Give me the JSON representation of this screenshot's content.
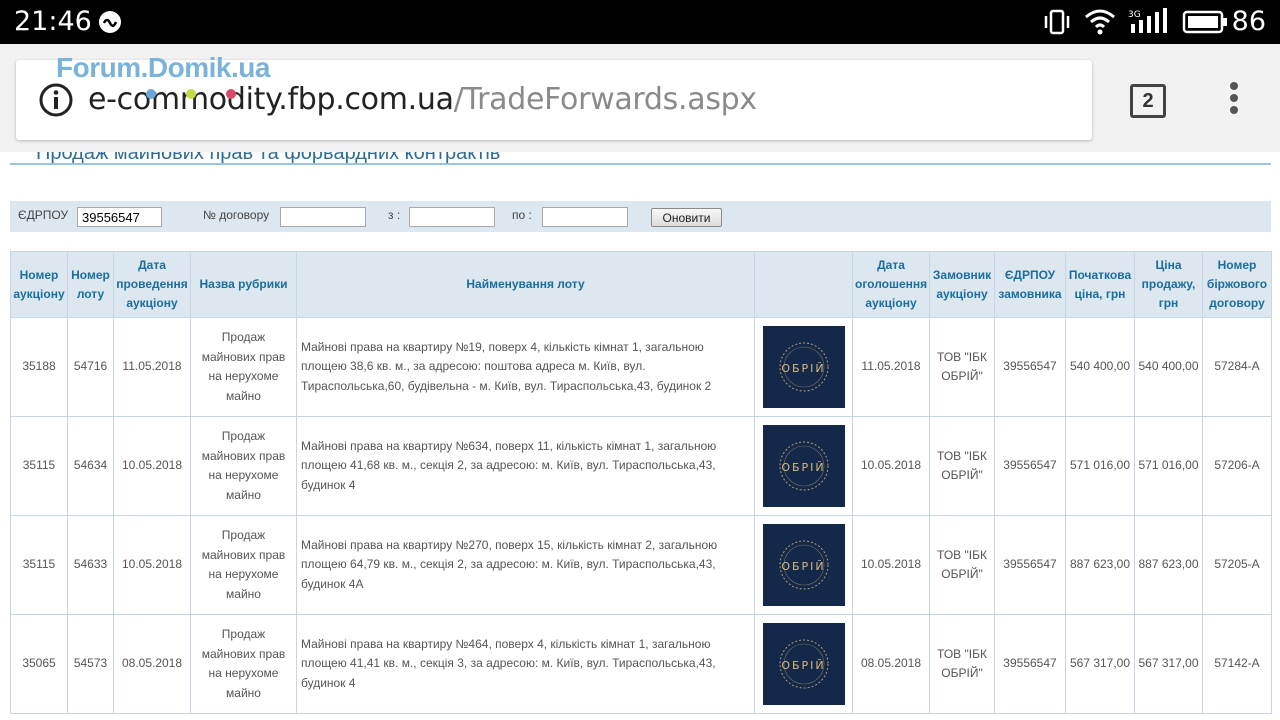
{
  "status_bar": {
    "time": "21:46",
    "battery": "86",
    "network": "3G"
  },
  "browser": {
    "url_domain": "e-commodity.fbp.com.ua",
    "url_path": "/TradeForwards.aspx",
    "tab_count": "2",
    "watermark": "Forum.Domik.ua"
  },
  "page": {
    "title": "Продаж майнових прав та форвардних контрактів",
    "filter": {
      "edrpou_label": "ЄДРПОУ",
      "edrpou_value": "39556547",
      "contract_label": "№ договору",
      "contract_value": "",
      "from_label": "з :",
      "from_value": "",
      "to_label": "по :",
      "to_value": "",
      "refresh_button": "Оновити"
    },
    "table": {
      "headers": [
        "Номер аукціону",
        "Номер лоту",
        "Дата проведення аукціону",
        "Назва рубрики",
        "Найменування лоту",
        "",
        "Дата оголошення аукціону",
        "Замовник аукціону",
        "ЄДРПОУ замовника",
        "Початкова ціна, грн",
        "Ціна продажу, грн",
        "Номер біржового договору"
      ],
      "logo_text": "ОБРІЙ",
      "rows": [
        {
          "auction": "35188",
          "lot": "54716",
          "date": "11.05.2018",
          "category": "Продаж майнових прав на нерухоме майно",
          "name": "Майнові права на квартиру №19, поверх 4, кількість кімнат 1, загальною площею 38,6 кв. м., за адресою: поштова адреса м. Київ, вул. Тираспольська,60, будівельна - м. Київ, вул. Тираспольська,43, будинок 2",
          "announce_date": "11.05.2018",
          "customer": "ТОВ \"ІБК ОБРІЙ\"",
          "customer_edrpou": "39556547",
          "start_price": "540 400,00",
          "sale_price": "540 400,00",
          "contract": "57284-А"
        },
        {
          "auction": "35115",
          "lot": "54634",
          "date": "10.05.2018",
          "category": "Продаж майнових прав на нерухоме майно",
          "name": "Майнові права на квартиру №634, поверх 11, кількість кімнат 1, загальною площею 41,68 кв. м., секція 2, за адресою: м. Київ, вул. Тираспольська,43, будинок 4",
          "announce_date": "10.05.2018",
          "customer": "ТОВ \"ІБК ОБРІЙ\"",
          "customer_edrpou": "39556547",
          "start_price": "571 016,00",
          "sale_price": "571 016,00",
          "contract": "57206-А"
        },
        {
          "auction": "35115",
          "lot": "54633",
          "date": "10.05.2018",
          "category": "Продаж майнових прав на нерухоме майно",
          "name": "Майнові права на квартиру №270, поверх 15, кількість кімнат 2, загальною площею 64,79 кв. м., секція 2, за адресою: м. Київ, вул. Тираспольська,43, будинок 4А",
          "announce_date": "10.05.2018",
          "customer": "ТОВ \"ІБК ОБРІЙ\"",
          "customer_edrpou": "39556547",
          "start_price": "887 623,00",
          "sale_price": "887 623,00",
          "contract": "57205-А"
        },
        {
          "auction": "35065",
          "lot": "54573",
          "date": "08.05.2018",
          "category": "Продаж майнових прав на нерухоме майно",
          "name": "Майнові права на квартиру №464, поверх 4, кількість кімнат 1, загальною площею 41,41 кв. м., секція 3, за адресою: м. Київ, вул. Тираспольська,43, будинок 4",
          "announce_date": "08.05.2018",
          "customer": "ТОВ \"ІБК ОБРІЙ\"",
          "customer_edrpou": "39556547",
          "start_price": "567 317,00",
          "sale_price": "567 317,00",
          "contract": "57142-А"
        }
      ]
    }
  },
  "colors": {
    "header_text": "#1a6e9e",
    "header_bg": "#dce7ef",
    "logo_bg": "#14284a",
    "logo_text": "#d9b97a"
  }
}
